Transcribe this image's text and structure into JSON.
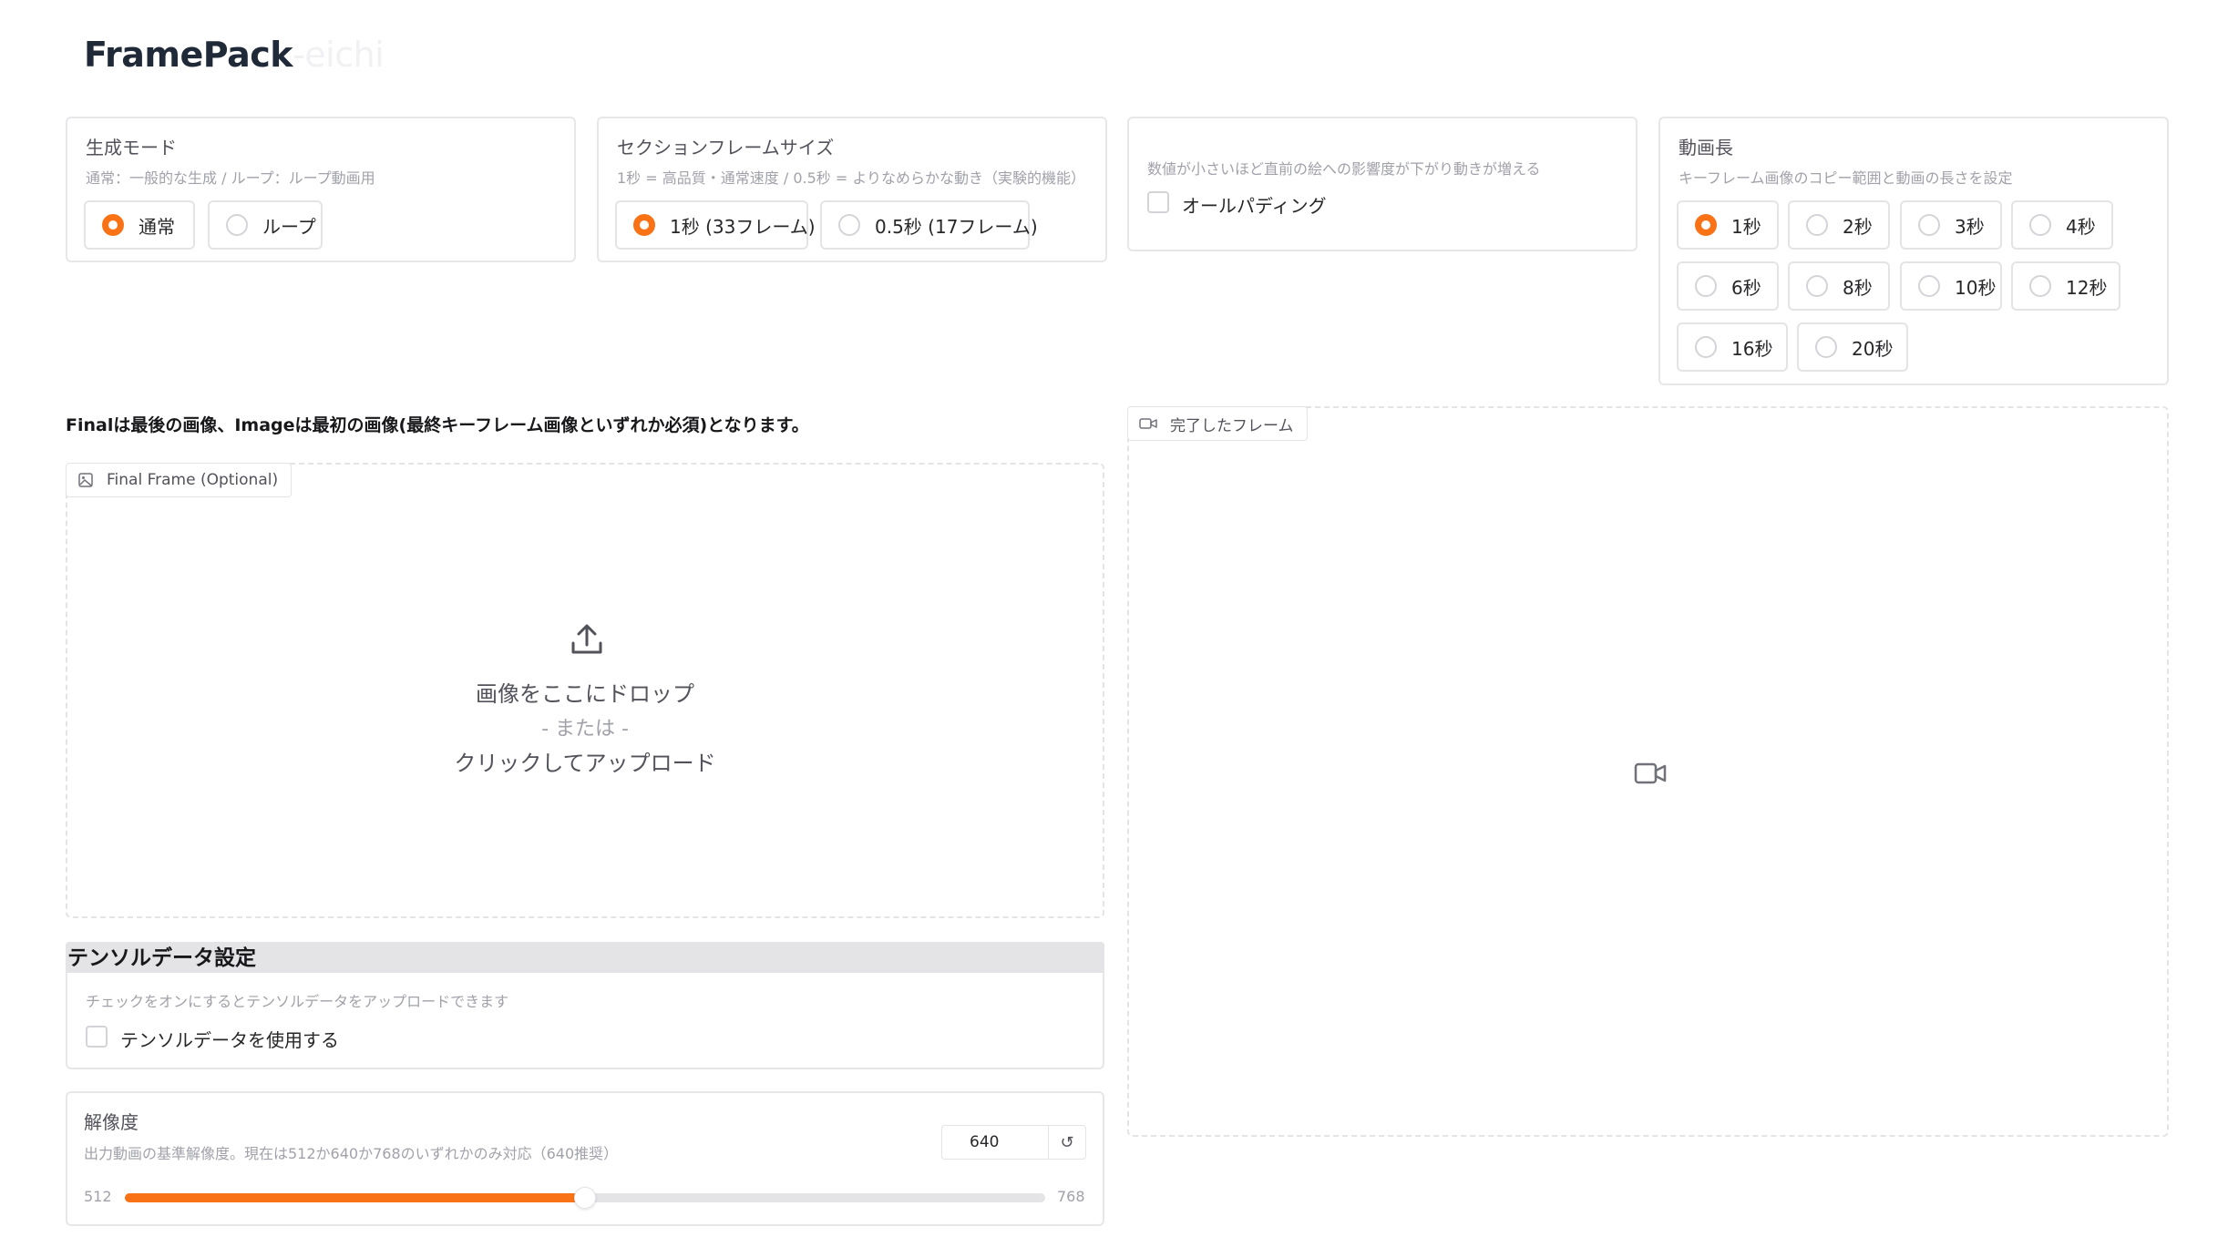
{
  "app": {
    "title": "FramePack",
    "title_suffix": "-eichi"
  },
  "generation_mode": {
    "label": "生成モード",
    "info": "通常：一般的な生成 / ループ：ループ動画用",
    "options": [
      "通常",
      "ループ"
    ],
    "selected": "通常"
  },
  "section_frame_size": {
    "label": "セクションフレームサイズ",
    "info": "1秒 = 高品質・通常速度 / 0.5秒 = よりなめらかな動き（実験的機能）",
    "options": [
      "1秒 (33フレーム)",
      "0.5秒 (17フレーム)"
    ],
    "selected": "1秒 (33フレーム)"
  },
  "all_padding": {
    "info": "数値が小さいほど直前の絵への影響度が下がり動きが増える",
    "checkbox_label": "オールパディング",
    "checked": false
  },
  "video_length": {
    "label": "動画長",
    "info": "キーフレーム画像のコピー範囲と動画の長さを設定",
    "options": [
      "1秒",
      "2秒",
      "3秒",
      "4秒",
      "6秒",
      "8秒",
      "10秒",
      "12秒",
      "16秒",
      "20秒"
    ],
    "selected": "1秒"
  },
  "note": "Finalは最後の画像、Imageは最初の画像(最終キーフレーム画像といずれか必須)となります。",
  "final_frame": {
    "tag": "Final Frame (Optional)",
    "drop_text": "画像をここにドロップ",
    "or_text": "- または -",
    "click_text": "クリックしてアップロード"
  },
  "completed_frames": {
    "tag": "完了したフレーム"
  },
  "tensor_settings": {
    "title": "テンソルデータ設定",
    "info": "チェックをオンにするとテンソルデータをアップロードできます",
    "checkbox_label": "テンソルデータを使用する",
    "checked": false
  },
  "resolution": {
    "label": "解像度",
    "info": "出力動画の基準解像度。現在は512か640か768のいずれかのみ対応（640推奨）",
    "value": "640",
    "min": "512",
    "max": "768",
    "reset_icon": "↺"
  },
  "colors": {
    "accent": "#f97316",
    "border": "#e4e4e7",
    "muted_text": "#a1a1aa"
  }
}
